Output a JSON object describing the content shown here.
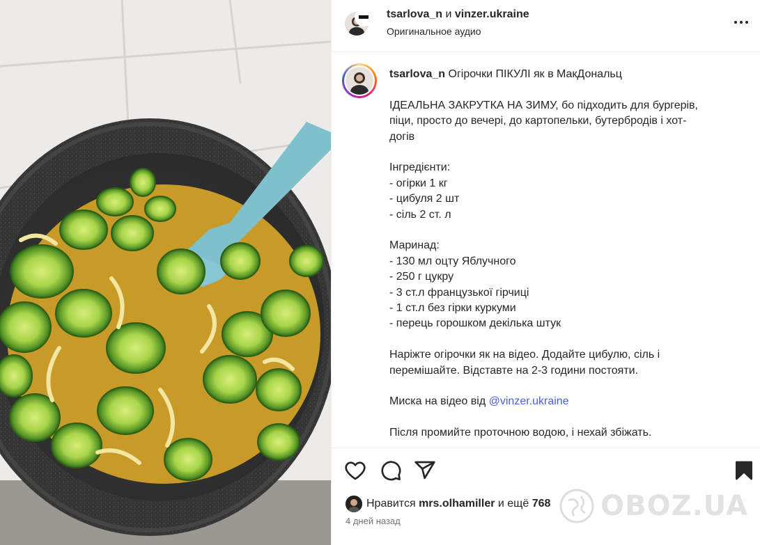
{
  "header": {
    "user1": "tsarlova_n",
    "joiner": "и",
    "user2": "vinzer.ukraine",
    "audio": "Оригинальное аудио",
    "more_icon": "more-horizontal-icon"
  },
  "caption": {
    "username": "tsarlova_n",
    "title": "Огірочки ПІКУЛІ як в МакДональц",
    "lines": [
      "",
      "ІДЕАЛЬНА ЗАКРУТКА НА ЗИМУ, бо підходить для бургерів,",
      "піци, просто до вечері, до картопельки, бутербродів і хот-",
      "догів",
      "",
      "Інгредієнти:",
      "- огірки 1 кг",
      "- цибуля 2 шт",
      "- сіль 2 ст. л",
      "",
      "Маринад:",
      "- 130 мл оцту Яблучного",
      "- 250 г цукру",
      "- 3 ст.л французької гірчиці",
      "- 1 ст.л без гірки куркуми",
      "- перець горошком декілька штук",
      "",
      "Наріжте огірочки як на відео. Додайте цибулю, сіль і",
      "перемішайте. Відставте на 2-3 години постояти.",
      "",
      "Миска на відео від",
      "",
      "Після промийте проточною водою, і нехай збіжать."
    ],
    "mention": "@vinzer.ukraine"
  },
  "actions": {
    "like_icon": "heart-icon",
    "comment_icon": "comment-icon",
    "share_icon": "send-icon",
    "save_icon": "bookmark-icon"
  },
  "likes": {
    "prefix": "Нравится",
    "user": "mrs.olhamiller",
    "middle": "и ещё",
    "count": "768"
  },
  "timestamp": "4 дней назад",
  "watermark": "OBOZ.UA",
  "colors": {
    "text": "#262626",
    "secondary": "#737373",
    "link": "#4a5fd6",
    "border": "#efefef"
  }
}
